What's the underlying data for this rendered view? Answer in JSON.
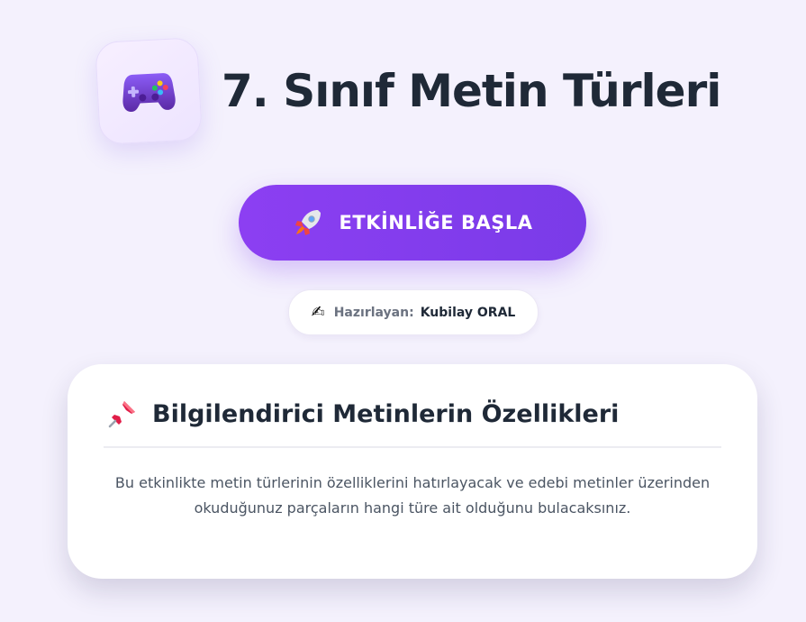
{
  "header": {
    "icon": "game-controller-icon",
    "title": "7. Sınıf Metin Türleri"
  },
  "start_button": {
    "icon": "rocket-icon",
    "label": "ETKİNLİĞE BAŞLA",
    "color": "#7c3aed"
  },
  "author": {
    "icon": "writing-hand-icon",
    "label": "Hazırlayan:",
    "name": "Kubilay ORAL"
  },
  "info_card": {
    "icon": "pushpin-icon",
    "title": "Bilgilendirici Metinlerin Özellikleri",
    "text_line1": "Bu etkinlikte metin türlerinin özelliklerini hatırlayacak ve edebi metinler üzerinden",
    "text_line2": "okuduğunuz parçaların hangi türe ait olduğunu bulacaksınız."
  }
}
